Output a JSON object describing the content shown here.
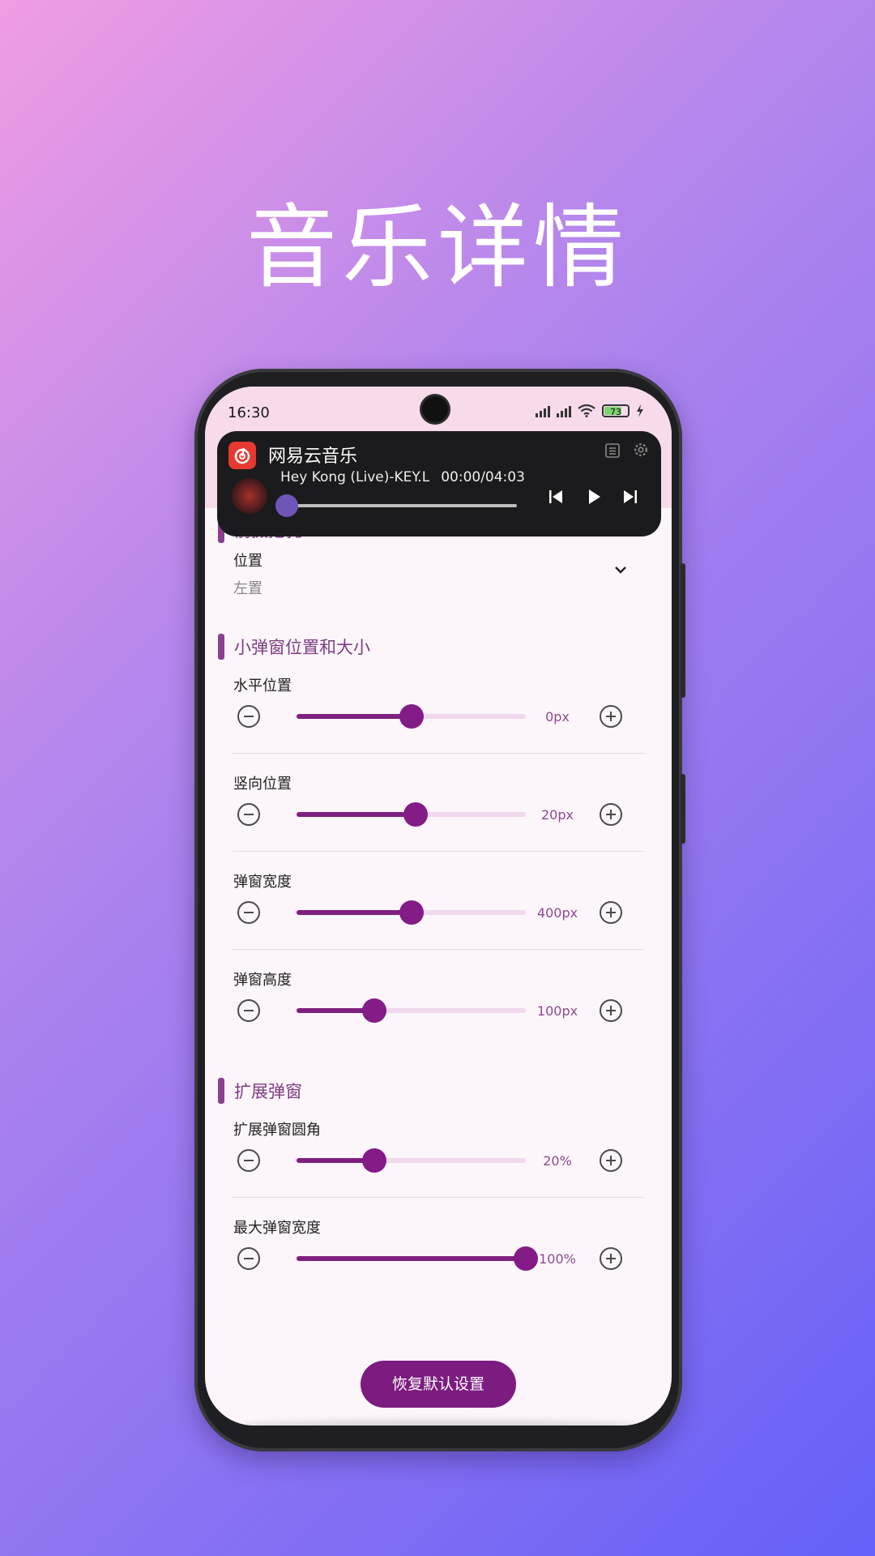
{
  "hero": {
    "title": "音乐详情"
  },
  "status_bar": {
    "time": "16:30",
    "battery": "73"
  },
  "music_widget": {
    "app_name": "网易云音乐",
    "song": "Hey Kong (Live)-KEY.L",
    "time": "00:00/04:03",
    "progress": 0
  },
  "sections": {
    "front_camera": {
      "title": "前摄挖孔",
      "position_label": "位置",
      "position_value": "左置"
    },
    "small_popup": {
      "title": "小弹窗位置和大小",
      "items": [
        {
          "label": "水平位置",
          "value": "0px",
          "fraction": 0.5
        },
        {
          "label": "竖向位置",
          "value": "20px",
          "fraction": 0.52
        },
        {
          "label": "弹窗宽度",
          "value": "400px",
          "fraction": 0.5
        },
        {
          "label": "弹窗高度",
          "value": "100px",
          "fraction": 0.34
        }
      ]
    },
    "expanded_popup": {
      "title": "扩展弹窗",
      "items": [
        {
          "label": "扩展弹窗圆角",
          "value": "20%",
          "fraction": 0.34
        },
        {
          "label": "最大弹窗宽度",
          "value": "100%",
          "fraction": 1.0
        }
      ]
    }
  },
  "reset_button": {
    "label": "恢复默认设置"
  },
  "colors": {
    "accent": "#7f1f80",
    "section_title": "#7d3c80",
    "track": "#f2d8ee"
  }
}
